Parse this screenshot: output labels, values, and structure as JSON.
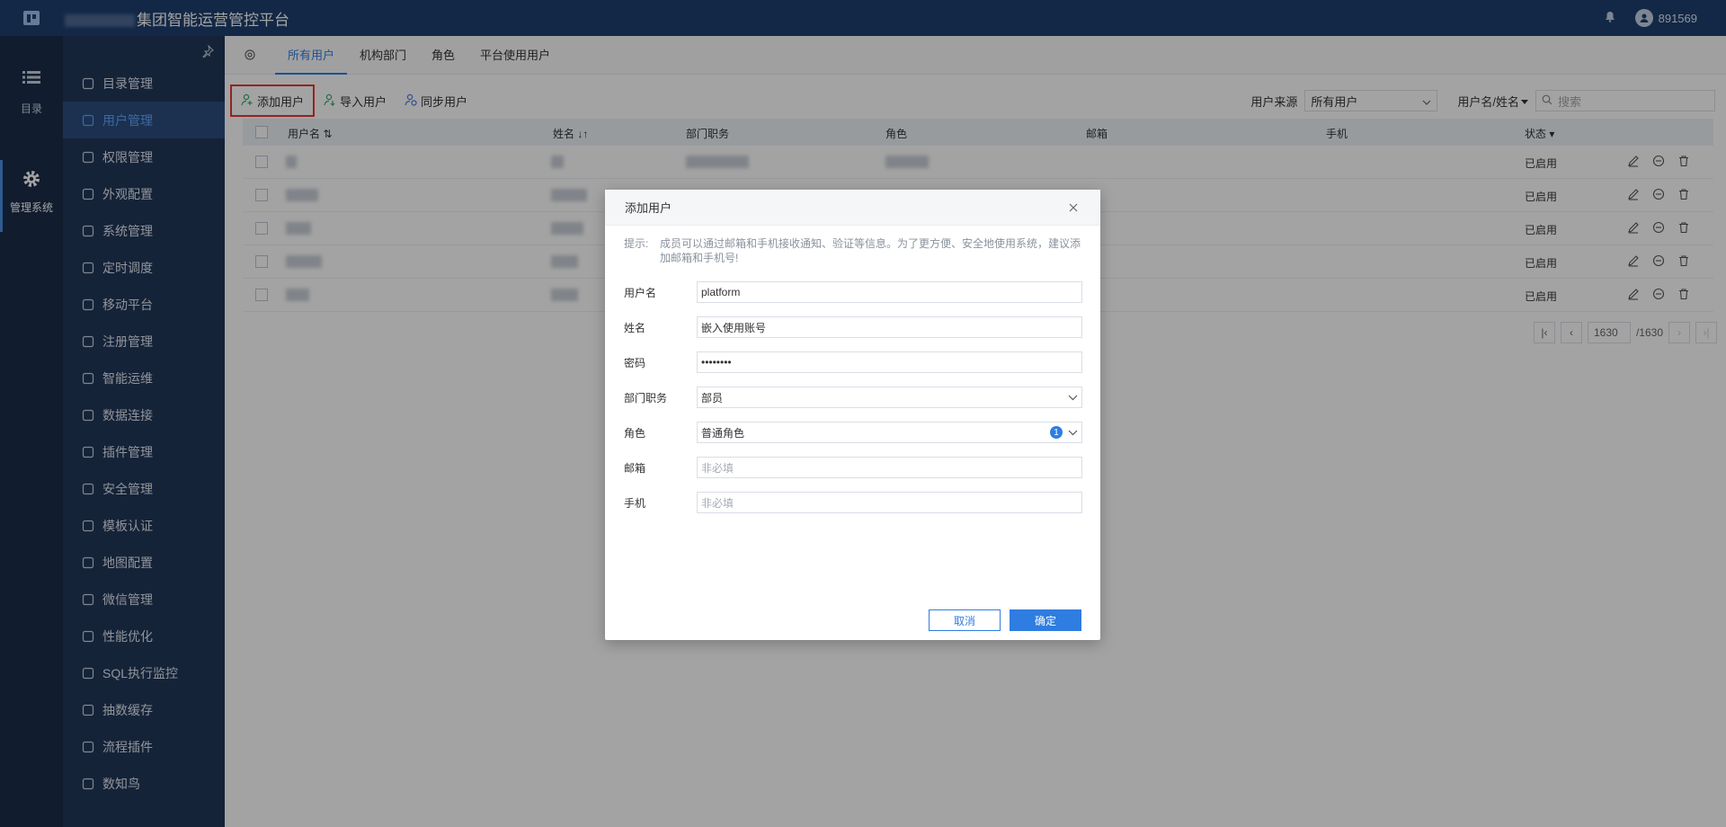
{
  "header": {
    "app_title": "集团智能运营管控平台",
    "username": "891569"
  },
  "rail": {
    "items": [
      {
        "label": "目录"
      },
      {
        "label": "管理系统"
      }
    ]
  },
  "sidebar": {
    "items": [
      {
        "label": "目录管理"
      },
      {
        "label": "用户管理"
      },
      {
        "label": "权限管理"
      },
      {
        "label": "外观配置"
      },
      {
        "label": "系统管理"
      },
      {
        "label": "定时调度"
      },
      {
        "label": "移动平台"
      },
      {
        "label": "注册管理"
      },
      {
        "label": "智能运维"
      },
      {
        "label": "数据连接"
      },
      {
        "label": "插件管理"
      },
      {
        "label": "安全管理"
      },
      {
        "label": "模板认证"
      },
      {
        "label": "地图配置"
      },
      {
        "label": "微信管理"
      },
      {
        "label": "性能优化"
      },
      {
        "label": "SQL执行监控"
      },
      {
        "label": "抽数缓存"
      },
      {
        "label": "流程插件"
      },
      {
        "label": "数知鸟"
      }
    ],
    "active_index": 1
  },
  "tabs": [
    {
      "label": "所有用户"
    },
    {
      "label": "机构部门"
    },
    {
      "label": "角色"
    },
    {
      "label": "平台使用用户"
    }
  ],
  "toolbar": {
    "add_user": "添加用户",
    "import_user": "导入用户",
    "sync_user": "同步用户",
    "source_label": "用户来源",
    "source_value": "所有用户",
    "search_field": "用户名/姓名",
    "search_placeholder": "搜索"
  },
  "table": {
    "columns": [
      "用户名",
      "姓名",
      "部门职务",
      "角色",
      "邮箱",
      "手机",
      "状态"
    ],
    "rows": [
      {
        "status": "已启用"
      },
      {
        "status": "已启用"
      },
      {
        "status": "已启用"
      },
      {
        "status": "已启用"
      },
      {
        "status": "已启用"
      }
    ]
  },
  "pagination": {
    "current": "1630",
    "total": "/1630"
  },
  "dialog": {
    "title": "添加用户",
    "hint_label": "提示:",
    "hint_text": "成员可以通过邮箱和手机接收通知、验证等信息。为了更方便、安全地使用系统，建议添加邮箱和手机号!",
    "fields": {
      "username": {
        "label": "用户名",
        "value": "platform"
      },
      "realname": {
        "label": "姓名",
        "value": "嵌入使用账号"
      },
      "password": {
        "label": "密码",
        "value": "••••••••"
      },
      "department": {
        "label": "部门职务",
        "value": "部员"
      },
      "role": {
        "label": "角色",
        "value": "普通角色",
        "count": "1"
      },
      "email": {
        "label": "邮箱",
        "placeholder": "非必填"
      },
      "phone": {
        "label": "手机",
        "placeholder": "非必填"
      }
    },
    "cancel_label": "取消",
    "ok_label": "确定"
  },
  "colors": {
    "accent": "#2f7de1",
    "topbar": "#1e3f6e",
    "sidebar": "#22375a",
    "rail": "#1b2d49",
    "highlight": "#e53935"
  }
}
